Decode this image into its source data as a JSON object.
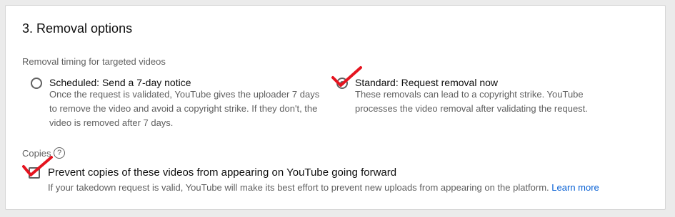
{
  "section": {
    "title": "3. Removal options"
  },
  "timing": {
    "label": "Removal timing for targeted videos",
    "options": [
      {
        "title": "Scheduled: Send a 7-day notice",
        "desc_lines": [
          "Once the request is validated, YouTube gives the uploader 7 days",
          "to remove the video and avoid a copyright strike. If they don't, the",
          "video is removed after 7 days."
        ],
        "selected": false
      },
      {
        "title": "Standard: Request removal now",
        "desc_lines": [
          "These removals can lead to a copyright strike. YouTube",
          "processes the video removal after validating the request."
        ],
        "selected": true
      }
    ]
  },
  "copies": {
    "label": "Copies",
    "help_icon": "?",
    "checkbox_label": "Prevent copies of these videos from appearing on YouTube going forward",
    "checked": true,
    "desc": "If your takedown request is valid, YouTube will make its best effort to prevent new uploads from appearing on the platform.",
    "learn_more": "Learn more"
  },
  "colors": {
    "accent_mark": "#e5141f",
    "link": "#065fd4",
    "secondary_text": "#606060",
    "primary_text": "#0f0f0f"
  },
  "icons": {
    "annotation_mark": "red-checkmark-icon"
  }
}
